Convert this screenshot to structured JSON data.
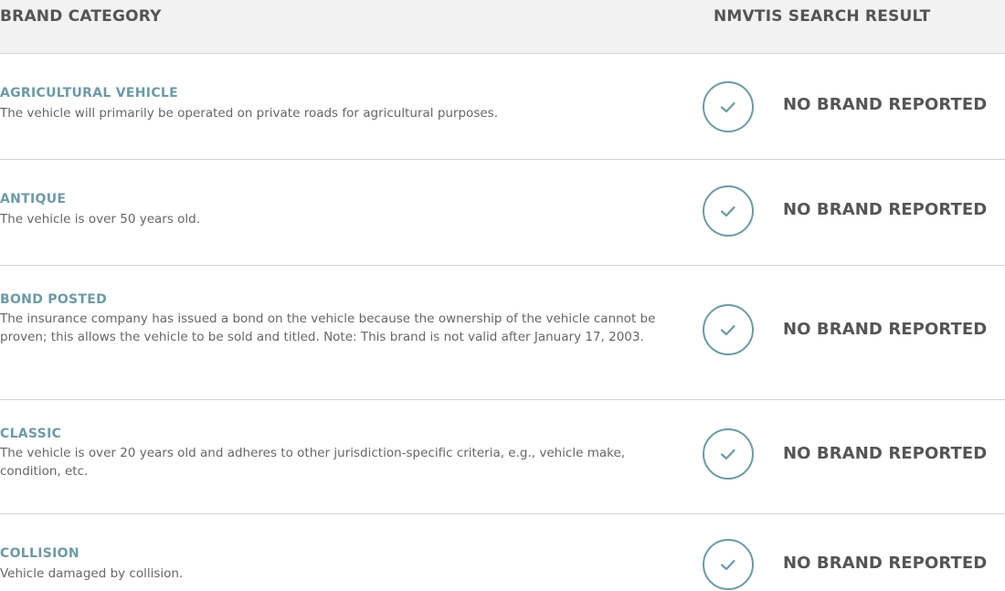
{
  "header": {
    "brand_category": "BRAND CATEGORY",
    "search_result": "NMVTIS SEARCH RESULT"
  },
  "rows": [
    {
      "title": "AGRICULTURAL VEHICLE",
      "description": "The vehicle will primarily be operated on private roads for agricultural purposes.",
      "icon": "check-circle-icon",
      "result": "NO BRAND REPORTED"
    },
    {
      "title": "ANTIQUE",
      "description": "The vehicle is over 50 years old.",
      "icon": "check-circle-icon",
      "result": "NO BRAND REPORTED"
    },
    {
      "title": "BOND POSTED",
      "description": "The insurance company has issued a bond on the vehicle because the ownership of the vehicle cannot be proven; this allows the vehicle to be sold and titled. Note: This brand is not valid after January 17, 2003.",
      "icon": "check-circle-icon",
      "result": "NO BRAND REPORTED"
    },
    {
      "title": "CLASSIC",
      "description": "The vehicle is over 20 years old and adheres to other jurisdiction-specific criteria, e.g., vehicle make, condition, etc.",
      "icon": "check-circle-icon",
      "result": "NO BRAND REPORTED"
    },
    {
      "title": "COLLISION",
      "description": "Vehicle damaged by collision.",
      "icon": "check-circle-icon",
      "result": "NO BRAND REPORTED"
    }
  ],
  "colors": {
    "accent": "#6d9aa6",
    "header_bg": "#f2f2f2",
    "text_dark": "#555555",
    "text_muted": "#666666",
    "divider": "#d4d4d4"
  }
}
